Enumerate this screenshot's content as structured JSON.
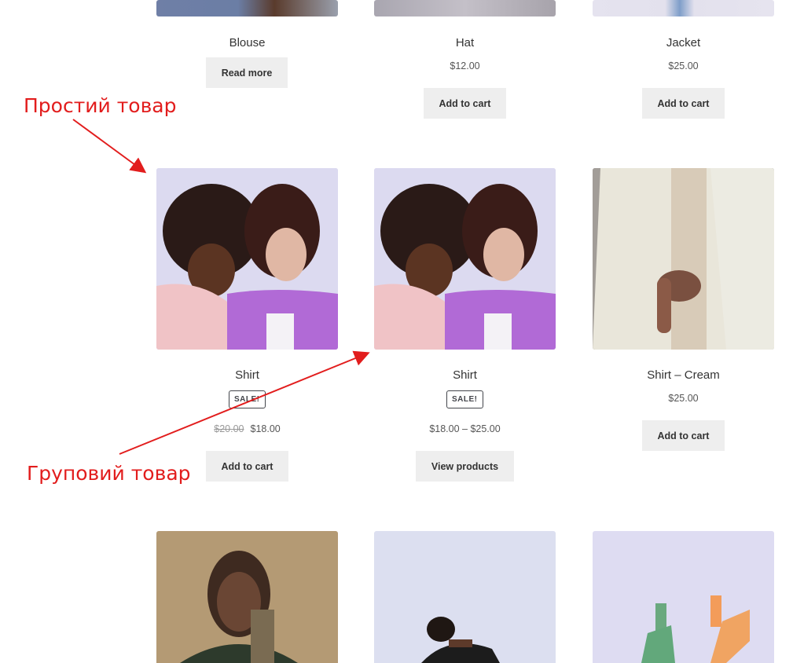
{
  "annotations": {
    "simple_product": "Простий товар",
    "grouped_product": "Груповий товар"
  },
  "row1": [
    {
      "name": "Blouse",
      "button": "Read more"
    },
    {
      "name": "Hat",
      "price": "$12.00",
      "button": "Add to cart"
    },
    {
      "name": "Jacket",
      "price": "$25.00",
      "button": "Add to cart"
    }
  ],
  "row2": [
    {
      "name": "Shirt",
      "badge": "SALE!",
      "old_price": "$20.00",
      "price": "$18.00",
      "button": "Add to cart"
    },
    {
      "name": "Shirt",
      "badge": "SALE!",
      "price": "$18.00 – $25.00",
      "button": "View products"
    },
    {
      "name": "Shirt – Cream",
      "price": "$25.00",
      "button": "Add to cart"
    }
  ],
  "colors": {
    "annotation": "#e21d1d",
    "button_bg": "#eeeeee"
  }
}
